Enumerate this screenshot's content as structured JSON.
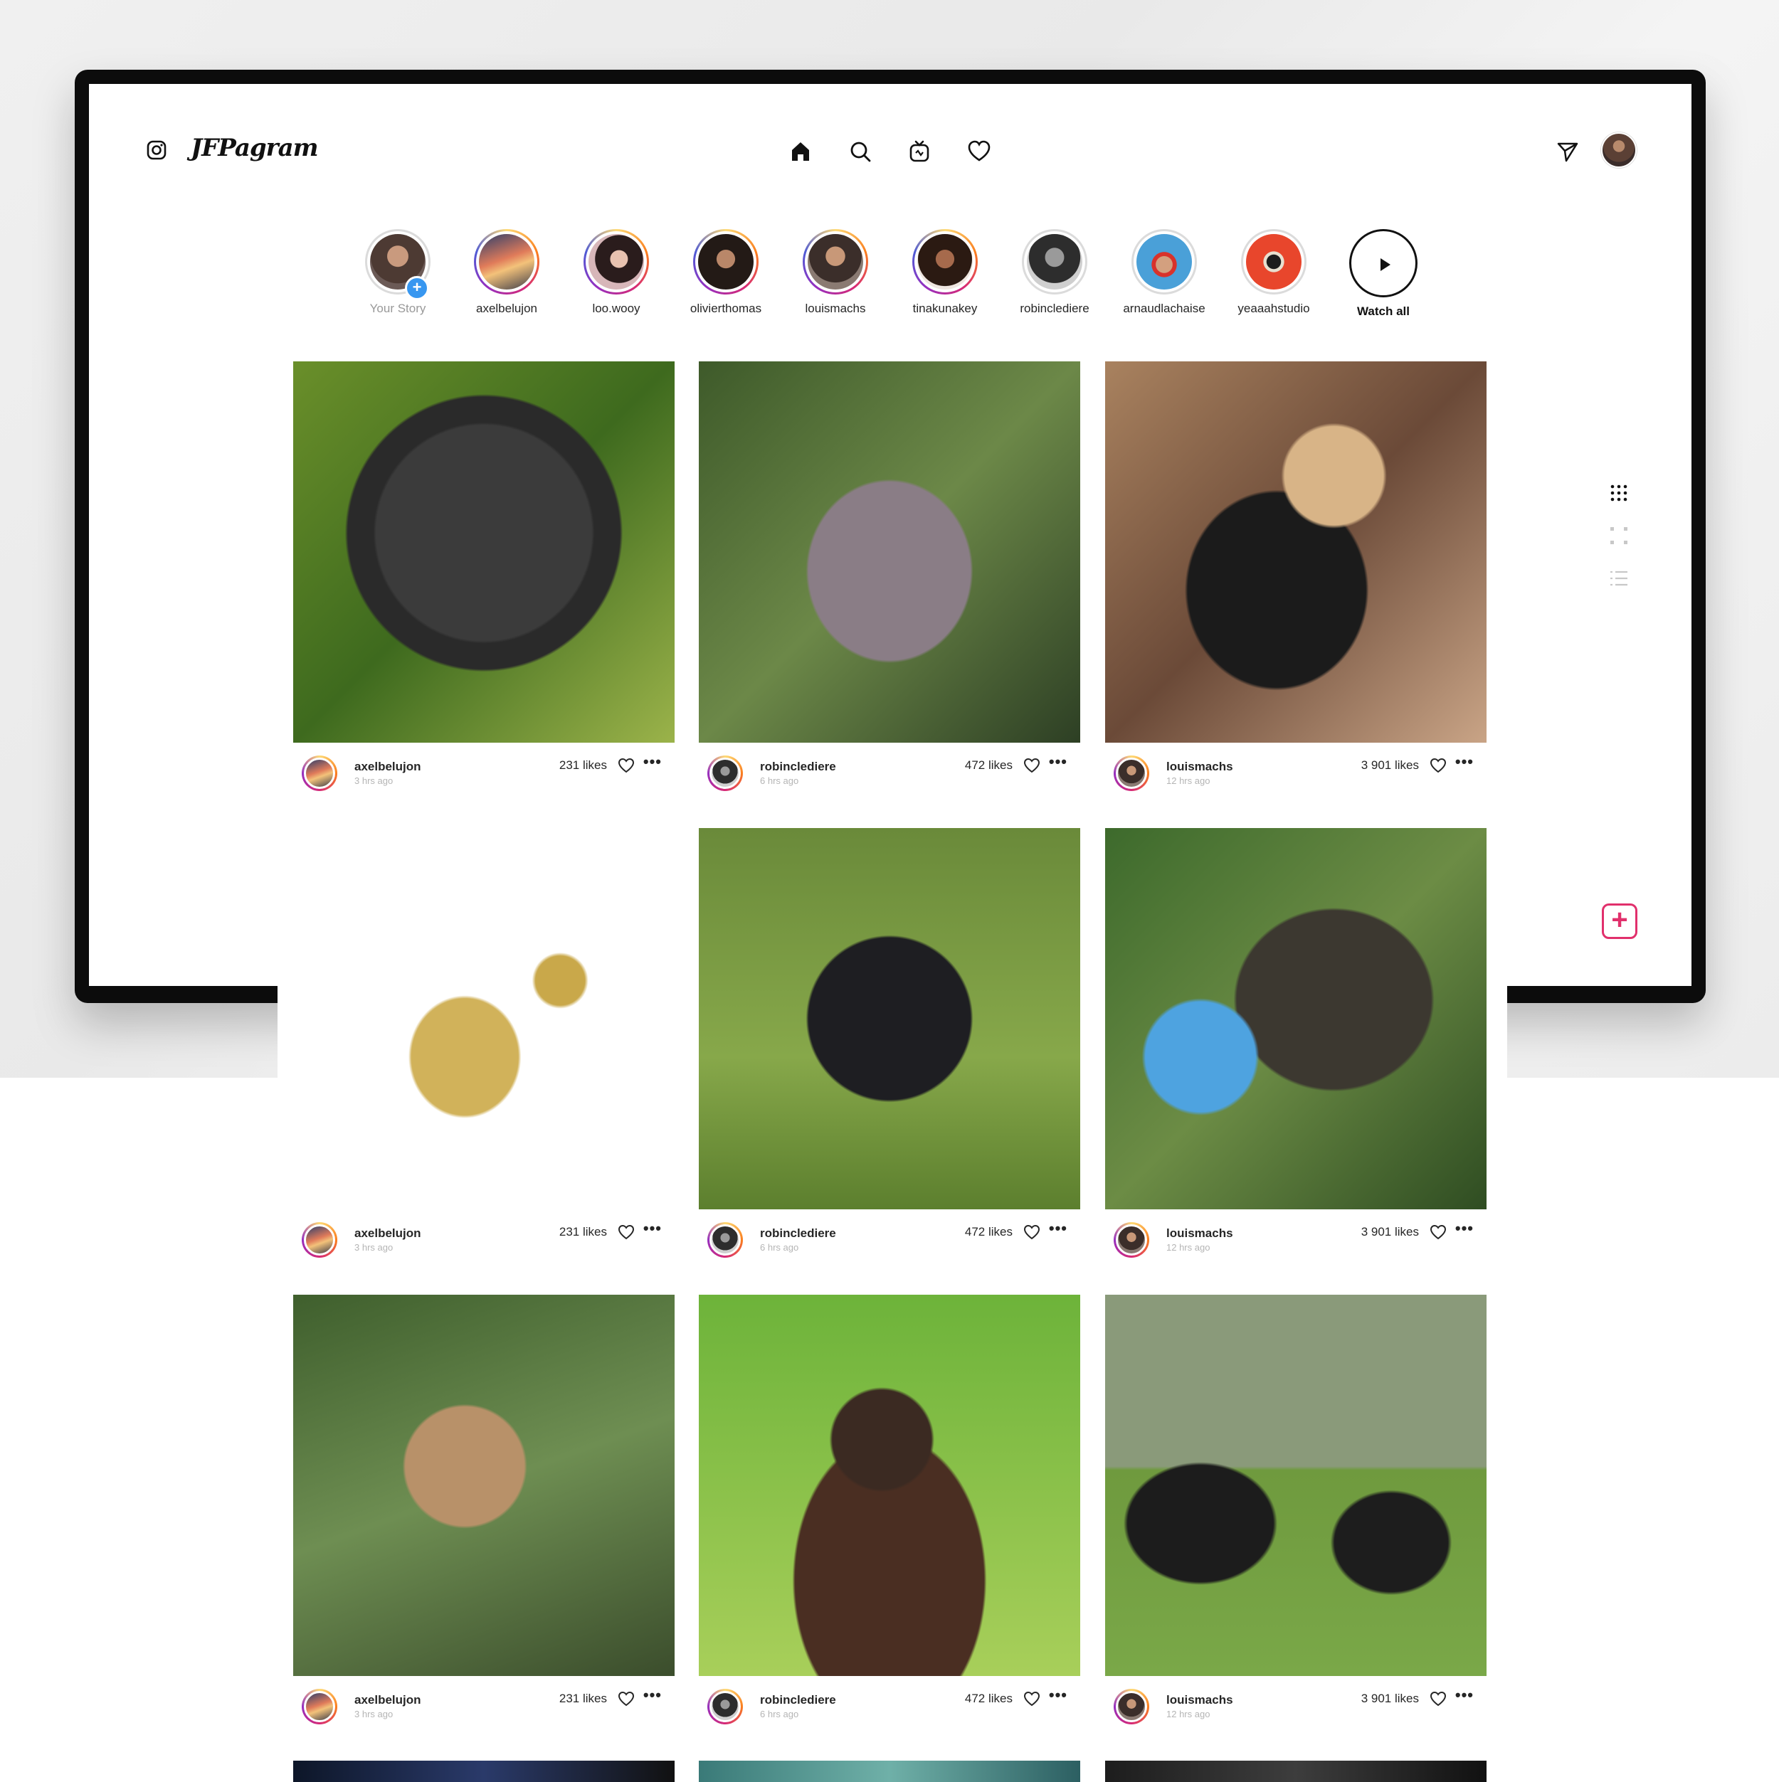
{
  "app": {
    "brand": "JFPagram"
  },
  "stories": [
    {
      "name": "Your Story",
      "own": true
    },
    {
      "name": "axelbelujon"
    },
    {
      "name": "loo.wooy"
    },
    {
      "name": "olivierthomas"
    },
    {
      "name": "louismachs"
    },
    {
      "name": "tinakunakey"
    },
    {
      "name": "robinclediere",
      "seen": true
    },
    {
      "name": "arnaudlachaise",
      "seen": true
    },
    {
      "name": "yeaaahstudio",
      "seen": true
    },
    {
      "name": "Watch all",
      "watch_all": true
    }
  ],
  "posts": [
    {
      "user": "axelbelujon",
      "time": "3 hrs ago",
      "likes": "231 likes"
    },
    {
      "user": "robinclediere",
      "time": "6 hrs ago",
      "likes": "472 likes"
    },
    {
      "user": "louismachs",
      "time": "12 hrs ago",
      "likes": "3 901 likes"
    },
    {
      "user": "axelbelujon",
      "time": "3 hrs ago",
      "likes": "231 likes"
    },
    {
      "user": "robinclediere",
      "time": "6 hrs ago",
      "likes": "472 likes"
    },
    {
      "user": "louismachs",
      "time": "12 hrs ago",
      "likes": "3 901 likes"
    },
    {
      "user": "axelbelujon",
      "time": "3 hrs ago",
      "likes": "231 likes"
    },
    {
      "user": "robinclediere",
      "time": "6 hrs ago",
      "likes": "472 likes"
    },
    {
      "user": "louismachs",
      "time": "12 hrs ago",
      "likes": "3 901 likes"
    }
  ],
  "icons": {
    "logo": "instagram-icon",
    "nav": [
      "home-icon",
      "search-icon",
      "igtv-icon",
      "heart-icon"
    ],
    "direct": "send-icon",
    "post_actions": [
      "heart-icon",
      "more-icon"
    ],
    "view_modes": [
      "grid-icon",
      "large-grid-icon",
      "list-icon"
    ],
    "new_post": "plus-icon"
  },
  "colors": {
    "story_ring": [
      "#feda75",
      "#fa7e1e",
      "#d62976",
      "#962fbf",
      "#4f5bd5"
    ],
    "add_badge": "#3897f0",
    "new_post_accent": "#e1306c"
  }
}
